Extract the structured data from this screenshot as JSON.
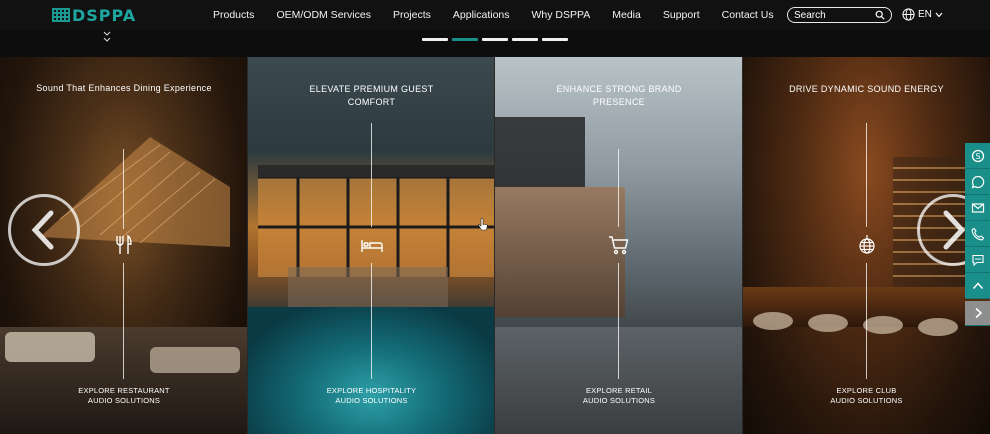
{
  "header": {
    "logo_text": "DSPPA",
    "nav": [
      "Products",
      "OEM/ODM Services",
      "Projects",
      "Applications",
      "Why DSPPA",
      "Media",
      "Support",
      "Contact Us"
    ],
    "search": {
      "placeholder": "Search"
    },
    "language": "EN"
  },
  "slider": {
    "dots": 5,
    "active_dot": 1
  },
  "panels": [
    {
      "title": "Sound That Enhances Dining Experience",
      "icon": "fork-knife-icon",
      "explore_line1": "EXPLORE RESTAURANT",
      "explore_line2": "AUDIO SOLUTIONS"
    },
    {
      "title": "ELEVATE PREMIUM GUEST COMFORT",
      "icon": "bed-icon",
      "explore_line1": "EXPLORE HOSPITALITY",
      "explore_line2": "AUDIO SOLUTIONS"
    },
    {
      "title": "ENHANCE STRONG BRAND PRESENCE",
      "icon": "shopping-cart-icon",
      "explore_line1": "EXPLORE RETAIL",
      "explore_line2": "AUDIO SOLUTIONS"
    },
    {
      "title": "DRIVE DYNAMIC SOUND ENERGY",
      "icon": "disco-ball-icon",
      "explore_line1": "EXPLORE CLUB",
      "explore_line2": "AUDIO SOLUTIONS"
    }
  ],
  "side_tools": [
    "skype-icon",
    "whatsapp-icon",
    "email-icon",
    "phone-icon",
    "chat-icon",
    "back-to-top-icon",
    "collapse-arrow-icon"
  ],
  "colors": {
    "accent": "#1a8f89",
    "header_bg": "#111111"
  }
}
